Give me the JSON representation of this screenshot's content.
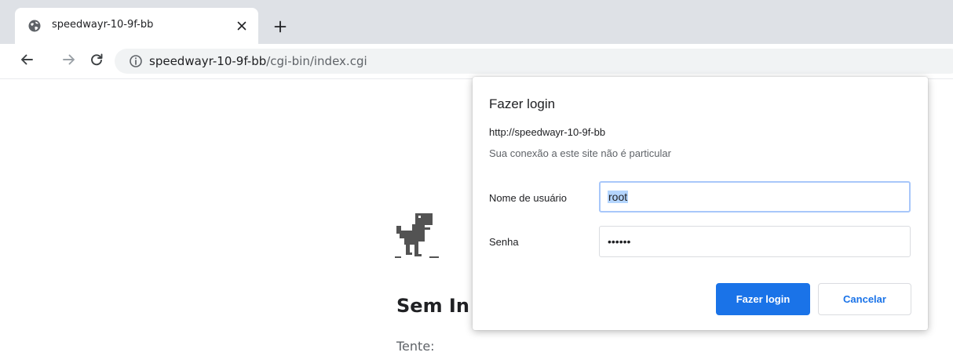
{
  "browser": {
    "tab": {
      "title": "speedwayr-10-9f-bb",
      "favicon": "globe-icon",
      "close_icon": "close-icon"
    },
    "new_tab_icon": "plus-icon",
    "nav": {
      "back_icon": "arrow-left-icon",
      "forward_icon": "arrow-right-icon",
      "reload_icon": "reload-icon"
    },
    "omnibox": {
      "info_icon": "info-icon",
      "host": "speedwayr-10-9f-bb",
      "path": "/cgi-bin/index.cgi"
    }
  },
  "page": {
    "dino_icon": "offline-dino-icon",
    "heading": "Sem In",
    "try_text": "Tente:"
  },
  "dialog": {
    "title": "Fazer login",
    "origin": "http://speedwayr-10-9f-bb",
    "warning": "Sua conexão a este site não é particular",
    "username_label": "Nome de usuário",
    "username_value": "root",
    "password_label": "Senha",
    "password_value": "••••••",
    "login_button": "Fazer login",
    "cancel_button": "Cancelar"
  },
  "colors": {
    "accent": "#1a73e8",
    "tabstrip": "#dee1e6",
    "omnibox": "#f1f3f4",
    "focus_ring": "#a8c7fa",
    "selection": "#b4d5fe"
  }
}
